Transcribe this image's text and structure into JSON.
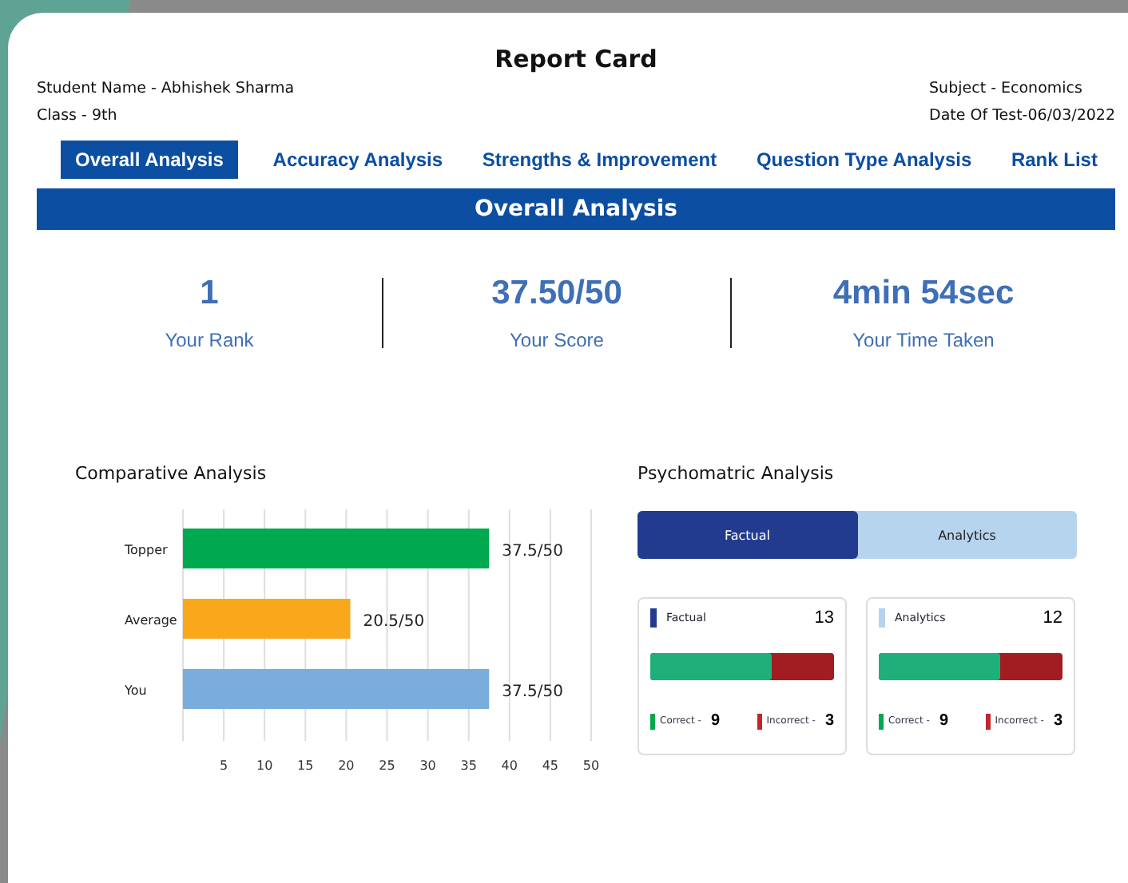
{
  "title": "Report Card",
  "info_left": [
    "Student Name - Abhishek Sharma",
    "Class - 9th"
  ],
  "info_right": [
    "Subject - Economics",
    "Date Of Test-06/03/2022"
  ],
  "tabs": [
    {
      "label": "Overall Analysis",
      "selected": true
    },
    {
      "label": "Accuracy Analysis",
      "selected": false
    },
    {
      "label": "Strengths & Improvement",
      "selected": false
    },
    {
      "label": "Question Type Analysis",
      "selected": false
    },
    {
      "label": "Rank List",
      "selected": false
    }
  ],
  "banner": "Overall Analysis",
  "stats": [
    {
      "value": "1",
      "label": "Your Rank"
    },
    {
      "value": "37.50/50",
      "label": "Your Score"
    },
    {
      "value": "4min 54sec",
      "label": "Your Time Taken"
    }
  ],
  "comparative": {
    "title": "Comparative Analysis",
    "chart_data": {
      "type": "bar",
      "orientation": "horizontal",
      "categories": [
        "Topper",
        "Average",
        "You"
      ],
      "values": [
        37.5,
        20.5,
        37.5
      ],
      "colors": [
        "#00a84f",
        "#f9a81b",
        "#7aaddc"
      ],
      "xlim": [
        0,
        50
      ],
      "grid": true,
      "xticks": [
        5,
        10,
        15,
        20,
        25,
        30,
        35,
        40,
        45,
        50
      ],
      "value_labels": [
        "37.5/50",
        "20.5/50",
        "37.5/50"
      ]
    }
  },
  "psychometric": {
    "title": "Psychomatric Analysis",
    "toggle": [
      {
        "label": "Factual",
        "selected": true
      },
      {
        "label": "Analytics",
        "selected": false
      }
    ],
    "cards": [
      {
        "name": "Factual",
        "color": "#223b8f",
        "total": "13",
        "level": 0.66,
        "correct_label": "Correct -",
        "correct": "9",
        "incorrect_label": "Incorrect -",
        "incorrect": "3"
      },
      {
        "name": "Analytics",
        "color": "#b4d3ee",
        "total": "12",
        "level": 0.66,
        "correct_label": "Correct -",
        "correct": "9",
        "incorrect_label": "Incorrect -",
        "incorrect": "3"
      }
    ]
  }
}
